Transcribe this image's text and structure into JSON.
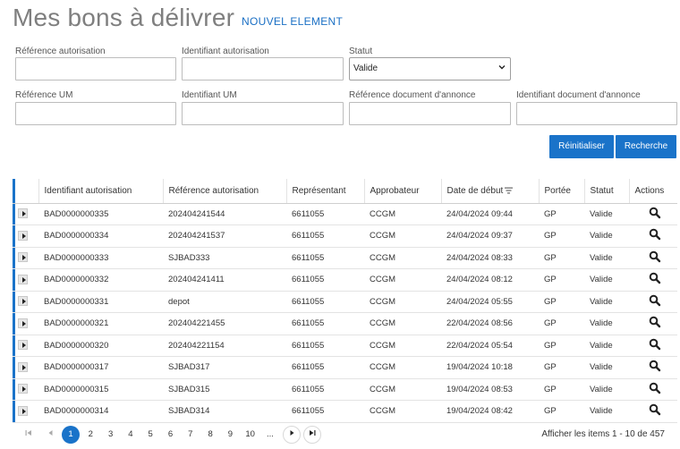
{
  "header": {
    "title": "Mes bons à délivrer",
    "new_link": "NOUVEL ELEMENT"
  },
  "filters": {
    "ref_autorisation_label": "Référence autorisation",
    "id_autorisation_label": "Identifiant autorisation",
    "statut_label": "Statut",
    "statut_value": "Valide",
    "ref_um_label": "Référence UM",
    "id_um_label": "Identifiant UM",
    "ref_doc_label": "Référence document d'annonce",
    "id_doc_label": "Identifiant document d'annonce"
  },
  "buttons": {
    "reset": "Réinitialiser",
    "search": "Recherche"
  },
  "table": {
    "columns": [
      "Identifiant autorisation",
      "Référence autorisation",
      "Représentant",
      "Approbateur",
      "Date de début",
      "Portée",
      "Statut",
      "Actions"
    ],
    "rows": [
      {
        "id": "BAD0000000335",
        "ref": "202404241544",
        "rep": "6611055",
        "appr": "CCGM",
        "date": "24/04/2024 09:44",
        "portee": "GP",
        "statut": "Valide"
      },
      {
        "id": "BAD0000000334",
        "ref": "202404241537",
        "rep": "6611055",
        "appr": "CCGM",
        "date": "24/04/2024 09:37",
        "portee": "GP",
        "statut": "Valide"
      },
      {
        "id": "BAD0000000333",
        "ref": "SJBAD333",
        "rep": "6611055",
        "appr": "CCGM",
        "date": "24/04/2024 08:33",
        "portee": "GP",
        "statut": "Valide"
      },
      {
        "id": "BAD0000000332",
        "ref": "202404241411",
        "rep": "6611055",
        "appr": "CCGM",
        "date": "24/04/2024 08:12",
        "portee": "GP",
        "statut": "Valide"
      },
      {
        "id": "BAD0000000331",
        "ref": "depot",
        "rep": "6611055",
        "appr": "CCGM",
        "date": "24/04/2024 05:55",
        "portee": "GP",
        "statut": "Valide"
      },
      {
        "id": "BAD0000000321",
        "ref": "202404221455",
        "rep": "6611055",
        "appr": "CCGM",
        "date": "22/04/2024 08:56",
        "portee": "GP",
        "statut": "Valide"
      },
      {
        "id": "BAD0000000320",
        "ref": "202404221154",
        "rep": "6611055",
        "appr": "CCGM",
        "date": "22/04/2024 05:54",
        "portee": "GP",
        "statut": "Valide"
      },
      {
        "id": "BAD0000000317",
        "ref": "SJBAD317",
        "rep": "6611055",
        "appr": "CCGM",
        "date": "19/04/2024 10:18",
        "portee": "GP",
        "statut": "Valide"
      },
      {
        "id": "BAD0000000315",
        "ref": "SJBAD315",
        "rep": "6611055",
        "appr": "CCGM",
        "date": "19/04/2024 08:53",
        "portee": "GP",
        "statut": "Valide"
      },
      {
        "id": "BAD0000000314",
        "ref": "SJBAD314",
        "rep": "6611055",
        "appr": "CCGM",
        "date": "19/04/2024 08:42",
        "portee": "GP",
        "statut": "Valide"
      }
    ]
  },
  "pager": {
    "first": "⏮",
    "prev": "◀",
    "pages": [
      "1",
      "2",
      "3",
      "4",
      "5",
      "6",
      "7",
      "8",
      "9",
      "10",
      "..."
    ],
    "active_page": "1",
    "next": "▶",
    "last": "⏭",
    "info": "Afficher les items 1 - 10 de 457"
  },
  "colors": {
    "accent": "#1a73c9",
    "title": "#7f7f7f"
  }
}
